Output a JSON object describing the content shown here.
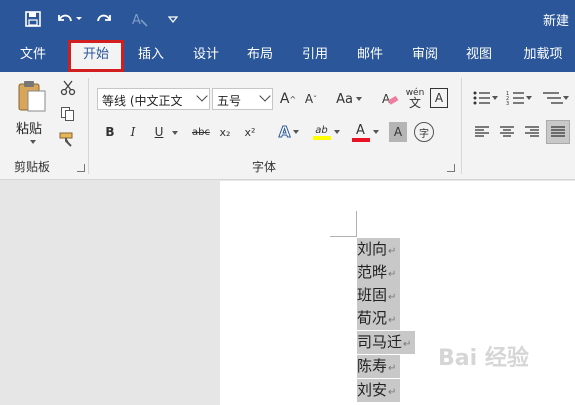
{
  "window": {
    "title": "新建"
  },
  "quick_access": {
    "save_icon": "save-icon",
    "undo_icon": "undo-icon",
    "redo_icon": "redo-icon",
    "format_icon": "format-painter-icon",
    "customize_icon": "customize-qat-icon"
  },
  "tabs": [
    {
      "label": "文件"
    },
    {
      "label": "开始",
      "active": true
    },
    {
      "label": "插入"
    },
    {
      "label": "设计"
    },
    {
      "label": "布局"
    },
    {
      "label": "引用"
    },
    {
      "label": "邮件"
    },
    {
      "label": "审阅"
    },
    {
      "label": "视图"
    },
    {
      "label": "加载项"
    }
  ],
  "clipboard": {
    "paste_label": "粘贴",
    "group_label": "剪贴板"
  },
  "font": {
    "font_name": "等线 (中文正文",
    "font_size": "五号",
    "group_label": "字体",
    "bold": "B",
    "italic": "I",
    "underline": "U",
    "strike": "abc",
    "subscript": "x₂",
    "superscript": "x²",
    "change_case": "Aa",
    "phonetic": "wén",
    "grow": "A",
    "shrink": "A",
    "text_effects": "A",
    "highlight": "ab",
    "font_color": "A",
    "char_shading": "A",
    "enclose": "字",
    "border_char": "A"
  },
  "document": {
    "lines": [
      "刘向",
      "范晔",
      "班固",
      "荀况",
      "司马迁",
      "陈寿",
      "刘安"
    ],
    "paragraph_mark": "↵"
  },
  "colors": {
    "brand": "#2b579a",
    "highlight_box": "#d21e1e",
    "selection": "#c8c8c8",
    "highlight_yellow": "#ffff00",
    "font_red": "#e81123"
  }
}
